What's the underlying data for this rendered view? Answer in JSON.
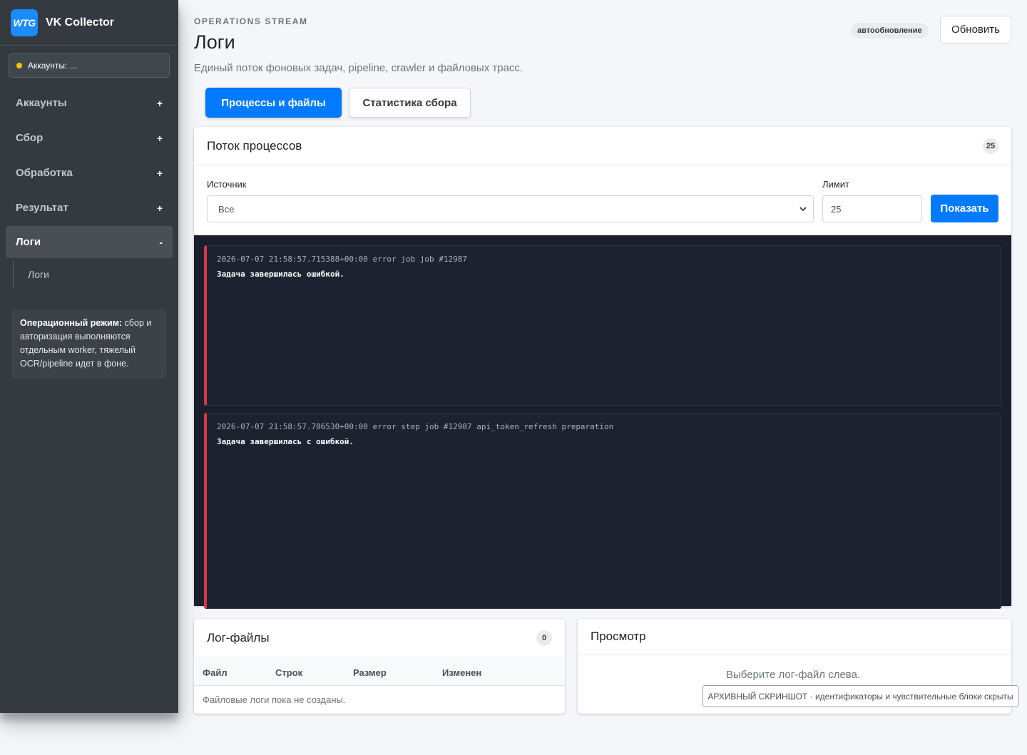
{
  "brand": {
    "logo": "WTG",
    "name": "VK Collector"
  },
  "accounts_pill": {
    "label": "Аккаунты: ..."
  },
  "sidebar": {
    "items": [
      {
        "label": "Аккаунты",
        "sign": "+"
      },
      {
        "label": "Сбор",
        "sign": "+"
      },
      {
        "label": "Обработка",
        "sign": "+"
      },
      {
        "label": "Результат",
        "sign": "+"
      },
      {
        "label": "Логи",
        "sign": "-"
      }
    ],
    "sub_item": "Логи",
    "info_bold": "Операционный режим:",
    "info_text": " сбор и авторизация выполняются отдельным worker, тяжелый OCR/pipeline идет в фоне."
  },
  "header": {
    "eyebrow": "OPERATIONS STREAM",
    "title": "Логи",
    "subtitle": "Единый поток фоновых задач, pipeline, crawler и файловых трасс.",
    "auto_badge": "автообновление",
    "refresh_label": "Обновить"
  },
  "tabs": [
    {
      "label": "Процессы и файлы"
    },
    {
      "label": "Статистика сбора"
    }
  ],
  "stream": {
    "title": "Поток процессов",
    "count": "25",
    "source_label": "Источник",
    "source_value": "Все",
    "limit_label": "Лимит",
    "limit_value": "25",
    "show_label": "Показать",
    "entries": [
      {
        "meta": "2026-07-07 21:58:57.715388+00:00 error job job #12987",
        "message": "Задача завершилась ошибкой."
      },
      {
        "meta": "2026-07-07 21:58:57.706530+00:00 error step job #12987 api_token_refresh preparation",
        "message": "Задача завершилась с ошибкой."
      }
    ]
  },
  "log_files": {
    "title": "Лог-файлы",
    "count": "0",
    "columns": [
      "Файл",
      "Строк",
      "Размер",
      "Изменен"
    ],
    "empty": "Файловые логи пока не созданы."
  },
  "preview": {
    "title": "Просмотр",
    "hint": "Выберите лог-файл слева."
  },
  "archive_note": "АРХИВНЫЙ СКРИНШОТ · идентификаторы и чувствительные блоки скрыты",
  "colors": {
    "primary": "#007bff",
    "sidebar": "#343a40",
    "error_accent": "#dc3545",
    "console_bg": "#1a1f2b"
  }
}
